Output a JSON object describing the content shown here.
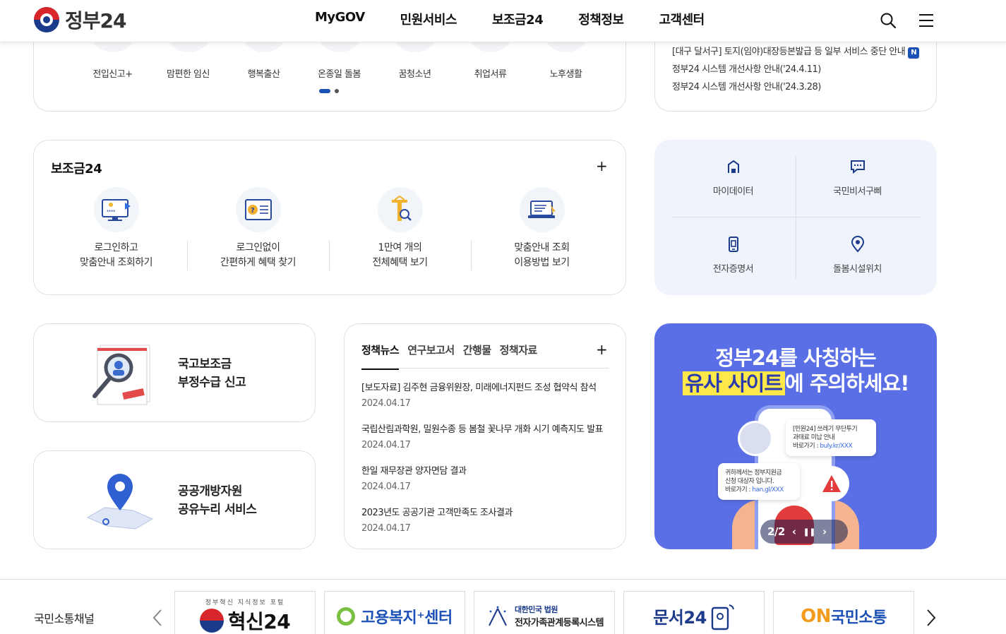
{
  "header": {
    "logo_text": "정부24",
    "nav": [
      "MyGOV",
      "민원서비스",
      "보조금24",
      "정책정보",
      "고객센터"
    ]
  },
  "quick_menu": {
    "items": [
      "전입신고+",
      "맘편한 임신",
      "행복출산",
      "온종일 돌봄",
      "꿈청소년",
      "취업서류",
      "노후생활"
    ],
    "page_active": 1,
    "page_total": 2
  },
  "notices": {
    "items": [
      {
        "text": "[대구 달서구] 토지(임야)대장등본발급 등 일부 서비스 중단 안내",
        "badge": "N"
      },
      {
        "text": "정부24 시스템 개선사항 안내('24.4.11)"
      },
      {
        "text": "정부24 시스템 개선사항 안내('24.3.28)"
      }
    ]
  },
  "subsidy": {
    "title": "보조금24",
    "plus": "+",
    "items": [
      {
        "line1": "로그인하고",
        "line2": "맞춤안내 조회하기"
      },
      {
        "line1": "로그인없이",
        "line2": "간편하게 혜택 찾기"
      },
      {
        "line1": "1만여 개의",
        "line2": "전체혜택 보기"
      },
      {
        "line1": "맞춤안내 조회",
        "line2": "이용방법 보기"
      }
    ]
  },
  "services": {
    "items": [
      "마이데이터",
      "국민비서구삐",
      "전자증명서",
      "돌봄시설위치"
    ]
  },
  "small_cards": [
    {
      "line1": "국고보조금",
      "line2": "부정수급 신고"
    },
    {
      "line1": "공공개방자원",
      "line2": "공유누리 서비스"
    }
  ],
  "policy_news": {
    "tabs": [
      "정책뉴스",
      "연구보고서",
      "간행물",
      "정책자료"
    ],
    "plus": "+",
    "items": [
      {
        "title": "[보도자료] 김주현 금융위원장, 미래에너지펀드 조성 협약식 참석",
        "date": "2024.04.17"
      },
      {
        "title": "국립산림과학원, 밀원수종 등 봄철 꽃나무 개화 시기 예측지도 발표",
        "date": "2024.04.17"
      },
      {
        "title": "한일 재무장관 양자면담 결과",
        "date": "2024.04.17"
      },
      {
        "title": "2023년도 공공기관 고객만족도 조사결과",
        "date": "2024.04.17"
      }
    ]
  },
  "banner": {
    "line1": "정부24를 사칭하는",
    "highlight": "유사 사이트",
    "line2_rest": "에 주의하세요!",
    "bubble1": {
      "l1": "[민원24] 쓰레기 무단투기",
      "l2": "과태료 미납 안내",
      "l3": "바로가기 : ",
      "link": "buly.kr/XXX"
    },
    "bubble2": {
      "l1": "귀하께서는 정부지원금",
      "l2": "신청 대상자 입니다.",
      "l3": "바로가기 : ",
      "link": "han.gl/XXX"
    },
    "pager": "2/2"
  },
  "channels": {
    "label": "국민소통채널",
    "items": [
      {
        "sub": "정부혁신 지식정보 포털",
        "name": "혁신24"
      },
      {
        "name": "고용복지⁺센터"
      },
      {
        "sub": "대한민국 법원",
        "name": "전자가족관계등록시스템"
      },
      {
        "name": "문서24"
      },
      {
        "prefix": "ON",
        "name": "국민소통"
      }
    ]
  },
  "colors": {
    "primary": "#1b50b5",
    "banner_bg": "#5a6fe6",
    "highlight": "#ffe84a"
  }
}
